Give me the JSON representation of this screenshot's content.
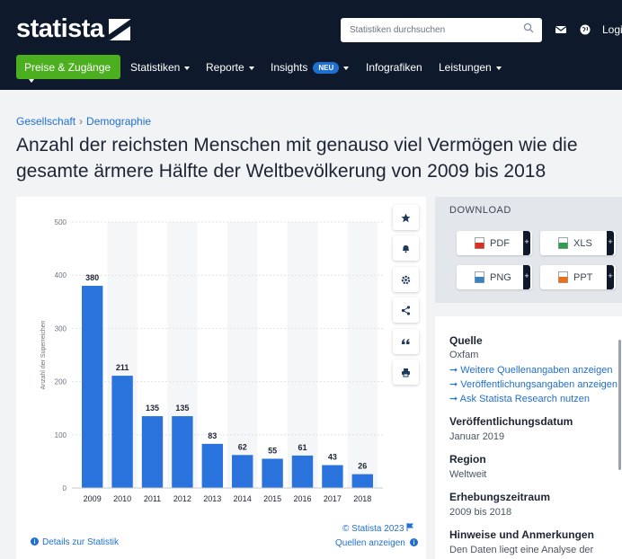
{
  "header": {
    "logo": "statista",
    "search_placeholder": "Statistiken durchsuchen",
    "login": "Login",
    "nav": {
      "pill": "Preise & Zugänge",
      "items": [
        "Statistiken",
        "Reporte",
        "Insights",
        "Infografiken",
        "Leistungen"
      ],
      "badge": "NEU"
    },
    "colors": {
      "nav_bg": "#0e1a2b",
      "pill_bg": "#4caf1f",
      "link": "#1f6fd1",
      "bar": "#2a72dc"
    }
  },
  "breadcrumb": [
    "Gesellschaft",
    "Demographie"
  ],
  "title": "Anzahl der reichsten Menschen mit genauso viel Vermögen wie die gesamte ärmere Hälfte der Weltbevölkerung von 2009 bis 2018",
  "chart_data": {
    "type": "bar",
    "categories": [
      "2009",
      "2010",
      "2011",
      "2012",
      "2013",
      "2014",
      "2015",
      "2016",
      "2017",
      "2018"
    ],
    "values": [
      380,
      211,
      135,
      135,
      83,
      62,
      55,
      61,
      43,
      26
    ],
    "ylabel": "Anzahl der Superreichen",
    "yticks": [
      0,
      100,
      200,
      300,
      400,
      500
    ],
    "ylim": [
      0,
      500
    ],
    "grid": true,
    "data_labels": true
  },
  "chart_footer": {
    "copyright": "© Statista 2023",
    "details": "Details zur Statistik",
    "sources": "Quellen anzeigen"
  },
  "toolbar_icons": [
    "star-icon",
    "bell-icon",
    "gear-icon",
    "share-icon",
    "quote-icon",
    "print-icon"
  ],
  "download": {
    "title": "DOWNLOAD",
    "buttons": [
      "PDF",
      "XLS",
      "PNG",
      "PPT"
    ],
    "plus": "+"
  },
  "info": {
    "source_label": "Quelle",
    "source_value": "Oxfam",
    "links": [
      "Weitere Quellenangaben anzeigen",
      "Veröffentlichungsangaben anzeigen",
      "Ask Statista Research nutzen"
    ],
    "date_label": "Veröffentlichungsdatum",
    "date_value": "Januar 2019",
    "region_label": "Region",
    "region_value": "Weltweit",
    "period_label": "Erhebungszeitraum",
    "period_value": "2009 bis 2018",
    "notes_label": "Hinweise und Anmerkungen",
    "notes_value": "Den Daten liegt eine Analyse der"
  }
}
